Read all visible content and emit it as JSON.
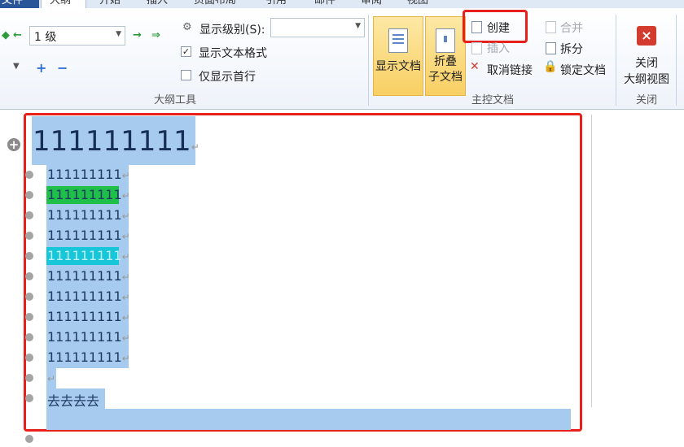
{
  "tabs": [
    "文件",
    "大纲",
    "开始",
    "插入",
    "页面布局",
    "引用",
    "邮件",
    "审阅",
    "视图"
  ],
  "outline_tools": {
    "level_value": "1 级",
    "show_level_label": "显示级别(S):",
    "show_text_format_label": "显示文本格式",
    "show_text_format_checked": "✓",
    "first_line_only_label": "仅显示首行",
    "group_label": "大纲工具"
  },
  "master_doc": {
    "show_doc_label": "显示文档",
    "collapse_label_1": "折叠",
    "collapse_label_2": "子文档",
    "create_label": "创建",
    "insert_label": "插入",
    "unlink_label": "取消链接",
    "merge_label": "合并",
    "split_label": "拆分",
    "lock_label": "锁定文档",
    "group_label": "主控文档"
  },
  "close_group": {
    "close_label_1": "关闭",
    "close_label_2": "大纲视图",
    "group_label": "关闭"
  },
  "document": {
    "heading": "111111111",
    "lines": [
      "111111111",
      "111111111",
      "111111111",
      "111111111",
      "111111111",
      "111111111",
      "111111111",
      "111111111",
      "111111111",
      "111111111"
    ],
    "last_line": "去去去去",
    "paragraph_mark": "↵"
  },
  "colors": {
    "selection": "#a6cbee",
    "highlight_green": "#1ec04a",
    "highlight_cyan": "#17c6d8",
    "annotation_red": "#e8201b"
  }
}
